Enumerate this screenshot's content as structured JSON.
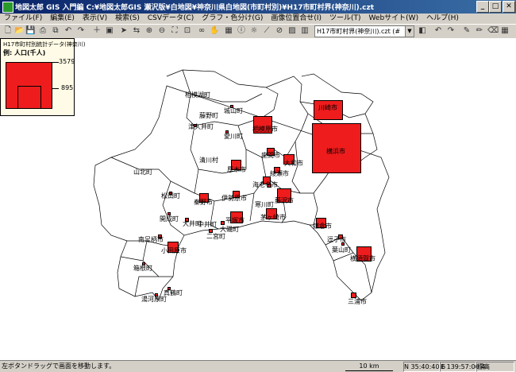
{
  "window": {
    "title": "地図太郎 GIS 入門編  C:¥地図太郎GIS 瀬沢版¥白地図¥神奈川県白地図(市町村別)¥H17市町村界(神奈川).czt"
  },
  "menu": [
    "ファイル(F)",
    "編集(E)",
    "表示(V)",
    "検索(S)",
    "CSVデータ(C)",
    "グラフ・色分け(G)",
    "画像位置合せ(I)",
    "ツール(T)",
    "Webサイト(W)",
    "ヘルプ(H)"
  ],
  "toolbar": {
    "file_select": "H17市町村界(神奈川).czt (#"
  },
  "legend": {
    "title": "H17市町村別統計データ(神奈川)",
    "subtitle": "例: 人口(千人)",
    "max_value": "3579",
    "mid_value": "895"
  },
  "municipalities": [
    {
      "name": "相模湖町",
      "population": null
    },
    {
      "name": "藤野町",
      "population": null
    },
    {
      "name": "津久井町",
      "population": null
    },
    {
      "name": "城山町",
      "population": null
    },
    {
      "name": "相模原市",
      "population": null
    },
    {
      "name": "川崎市",
      "population": null
    },
    {
      "name": "愛川町",
      "population": null
    },
    {
      "name": "清川村",
      "population": null
    },
    {
      "name": "座間市",
      "population": null
    },
    {
      "name": "大和市",
      "population": null
    },
    {
      "name": "横浜市",
      "population": 3579
    },
    {
      "name": "厚木市",
      "population": null
    },
    {
      "name": "綾瀬市",
      "population": null
    },
    {
      "name": "山北町",
      "population": null
    },
    {
      "name": "海老名市",
      "population": null
    },
    {
      "name": "松田町",
      "population": null
    },
    {
      "name": "伊勢原市",
      "population": null
    },
    {
      "name": "藤沢市",
      "population": null
    },
    {
      "name": "秦野市",
      "population": null
    },
    {
      "name": "寒川町",
      "population": null
    },
    {
      "name": "開成町",
      "population": null
    },
    {
      "name": "大井町",
      "population": null
    },
    {
      "name": "中井町",
      "population": null
    },
    {
      "name": "平塚市",
      "population": null
    },
    {
      "name": "茅ヶ崎市",
      "population": null
    },
    {
      "name": "鎌倉市",
      "population": null
    },
    {
      "name": "大磯町",
      "population": null
    },
    {
      "name": "二宮町",
      "population": null
    },
    {
      "name": "逗子市",
      "population": null
    },
    {
      "name": "南足柄市",
      "population": null
    },
    {
      "name": "葉山町",
      "population": null
    },
    {
      "name": "小田原市",
      "population": null
    },
    {
      "name": "横須賀市",
      "population": null
    },
    {
      "name": "箱根町",
      "population": null
    },
    {
      "name": "真鶴町",
      "population": null
    },
    {
      "name": "湯河原町",
      "population": null
    },
    {
      "name": "三浦市",
      "population": null
    }
  ],
  "statusbar": {
    "hint": "左ボタンドラッグで画面を移動します。",
    "scale": "10 km",
    "lat": "N 35:40:40.6",
    "lon": "E 139:57:06.4",
    "elev": "標高"
  },
  "colors": {
    "symbol": "#ee1c1c",
    "titlebar": "#0a246a"
  }
}
